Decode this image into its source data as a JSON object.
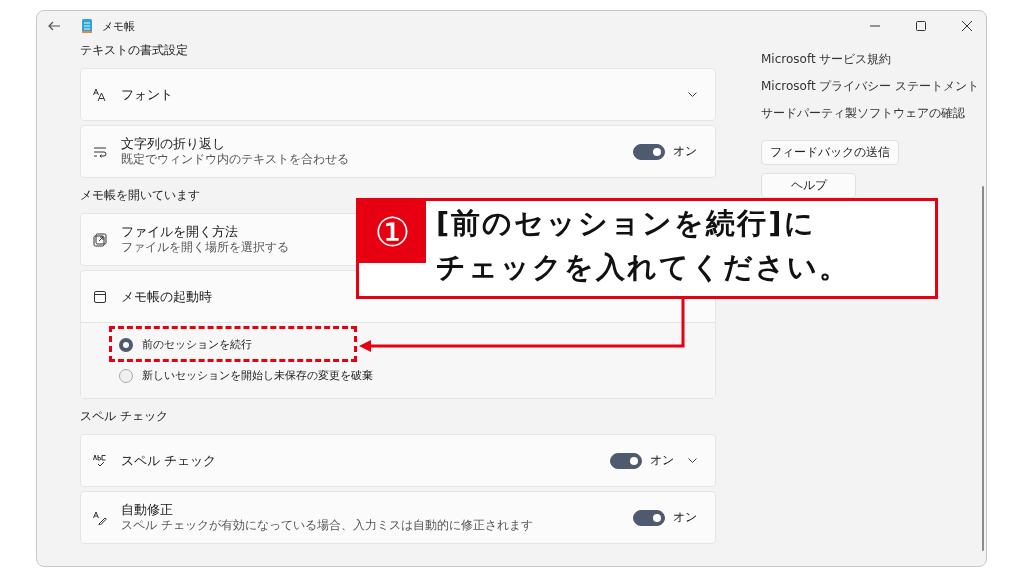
{
  "window": {
    "app_title": "メモ帳"
  },
  "sections": [
    {
      "heading": "テキストの書式設定",
      "rows": [
        {
          "kind": "dropdown",
          "label": "フォント",
          "expanded": false
        },
        {
          "kind": "toggle",
          "label": "文字列の折り返し",
          "description": "既定でウィンドウ内のテキストを合わせる",
          "on": true,
          "state_label": "オン"
        }
      ]
    },
    {
      "heading": "メモ帳を開いています",
      "rows": [
        {
          "kind": "plain",
          "label": "ファイルを開く方法",
          "description": "ファイルを開く場所を選択する"
        },
        {
          "kind": "radio_group",
          "label": "メモ帳の起動時",
          "options": [
            {
              "label": "前のセッションを続行",
              "selected": true
            },
            {
              "label": "新しいセッションを開始し未保存の変更を破棄",
              "selected": false
            }
          ]
        }
      ]
    },
    {
      "heading": "スペル チェック",
      "rows": [
        {
          "kind": "toggle",
          "label": "スペル チェック",
          "on": true,
          "state_label": "オン",
          "expanded": false
        },
        {
          "kind": "toggle",
          "label": "自動修正",
          "description": "スペル チェックが有効になっている場合、入力ミスは自動的に修正されます",
          "on": true,
          "state_label": "オン"
        }
      ]
    }
  ],
  "links": [
    "Microsoft サービス規約",
    "Microsoft プライバシー ステートメント",
    "サードパーティ製ソフトウェアの確認"
  ],
  "buttons": [
    "フィードバックの送信",
    "ヘルプ"
  ],
  "callout": {
    "number": "①",
    "lines": [
      "[前のセッションを続行]に",
      "チェックを入れてください。"
    ]
  }
}
